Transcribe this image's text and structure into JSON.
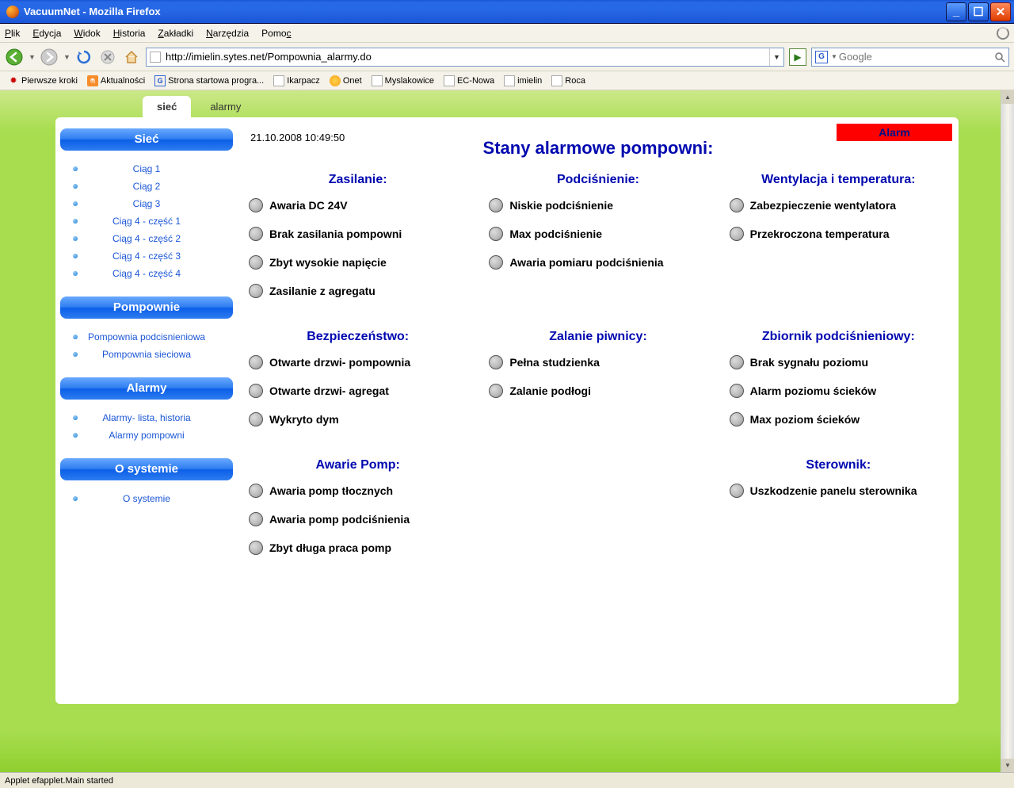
{
  "window": {
    "title": "VacuumNet - Mozilla Firefox"
  },
  "menu": {
    "file": "Plik",
    "edit": "Edycja",
    "view": "Widok",
    "history": "Historia",
    "bookmarks": "Zakładki",
    "tools": "Narzędzia",
    "help": "Pomoc"
  },
  "url": "http://imielin.sytes.net/Pompownia_alarmy.do",
  "search": {
    "placeholder": "Google"
  },
  "bookmarks": [
    "Pierwsze kroki",
    "Aktualności",
    "Strona startowa progra...",
    "Ikarpacz",
    "Onet",
    "Myslakowice",
    "EC-Nowa",
    "imielin",
    "Roca"
  ],
  "tabs": {
    "t1": "sieć",
    "t2": "alarmy"
  },
  "sidebar": {
    "h1": "Sieć",
    "s1": [
      "Ciąg 1",
      "Ciąg 2",
      "Ciąg 3",
      "Ciąg 4 - część 1",
      "Ciąg 4 - część 2",
      "Ciąg 4 - część 3",
      "Ciąg 4 - część 4"
    ],
    "h2": "Pompownie",
    "s2": [
      "Pompownia podcisnieniowa",
      "Pompownia sieciowa"
    ],
    "h3": "Alarmy",
    "s3": [
      "Alarmy- lista, historia",
      "Alarmy pompowni"
    ],
    "h4": "O systemie",
    "s4": [
      "O systemie"
    ]
  },
  "timestamp": "21.10.2008 10:49:50",
  "alarm_badge": "Alarm",
  "main_title": "Stany alarmowe pompowni:",
  "groups": {
    "zasilanie": {
      "title": "Zasilanie:",
      "items": [
        "Awaria DC 24V",
        "Brak zasilania pompowni",
        "Zbyt wysokie napięcie",
        "Zasilanie z agregatu"
      ]
    },
    "podcisnienie": {
      "title": "Podciśnienie:",
      "items": [
        "Niskie podciśnienie",
        "Max podciśnienie",
        "Awaria pomiaru podciśnienia"
      ]
    },
    "wentylacja": {
      "title": "Wentylacja i temperatura:",
      "items": [
        "Zabezpieczenie wentylatora",
        "Przekroczona temperatura"
      ]
    },
    "bezp": {
      "title": "Bezpieczeństwo:",
      "items": [
        "Otwarte drzwi- pompownia",
        "Otwarte drzwi- agregat",
        "Wykryto dym"
      ]
    },
    "zalanie": {
      "title": "Zalanie piwnicy:",
      "items": [
        "Pełna studzienka",
        "Zalanie podłogi"
      ]
    },
    "zbiornik": {
      "title": "Zbiornik podciśnieniowy:",
      "items": [
        "Brak sygnału poziomu",
        "Alarm poziomu ścieków",
        "Max poziom ścieków"
      ]
    },
    "pompy": {
      "title": "Awarie Pomp:",
      "items": [
        "Awaria pomp tłocznych",
        "Awaria pomp podciśnienia",
        "Zbyt długa praca pomp"
      ]
    },
    "sterownik": {
      "title": "Sterownik:",
      "items": [
        "Uszkodzenie panelu sterownika"
      ]
    }
  },
  "status": "Applet efapplet.Main started"
}
